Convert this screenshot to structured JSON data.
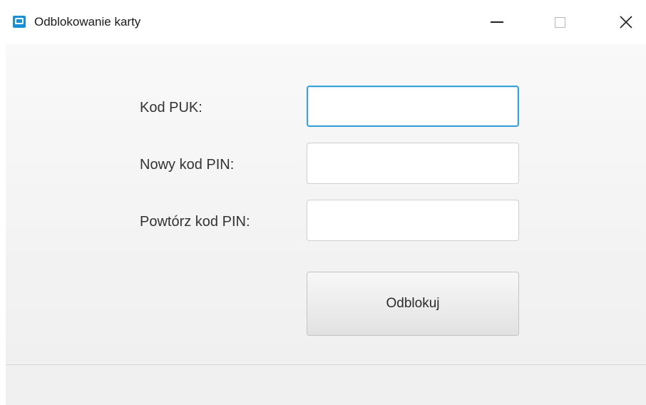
{
  "window": {
    "title": "Odblokowanie karty",
    "controls": {
      "minimize_icon": "minimize-icon",
      "maximize_icon": "maximize-icon",
      "close_icon": "close-icon"
    }
  },
  "form": {
    "fields": [
      {
        "label": "Kod PUK:",
        "value": "",
        "placeholder": ""
      },
      {
        "label": "Nowy kod PIN:",
        "value": "",
        "placeholder": ""
      },
      {
        "label": "Powtórz kod PIN:",
        "value": "",
        "placeholder": ""
      }
    ],
    "submit_label": "Odblokuj"
  },
  "colors": {
    "accent": "#1a8fd4",
    "focus_border": "#3aa0d8"
  }
}
